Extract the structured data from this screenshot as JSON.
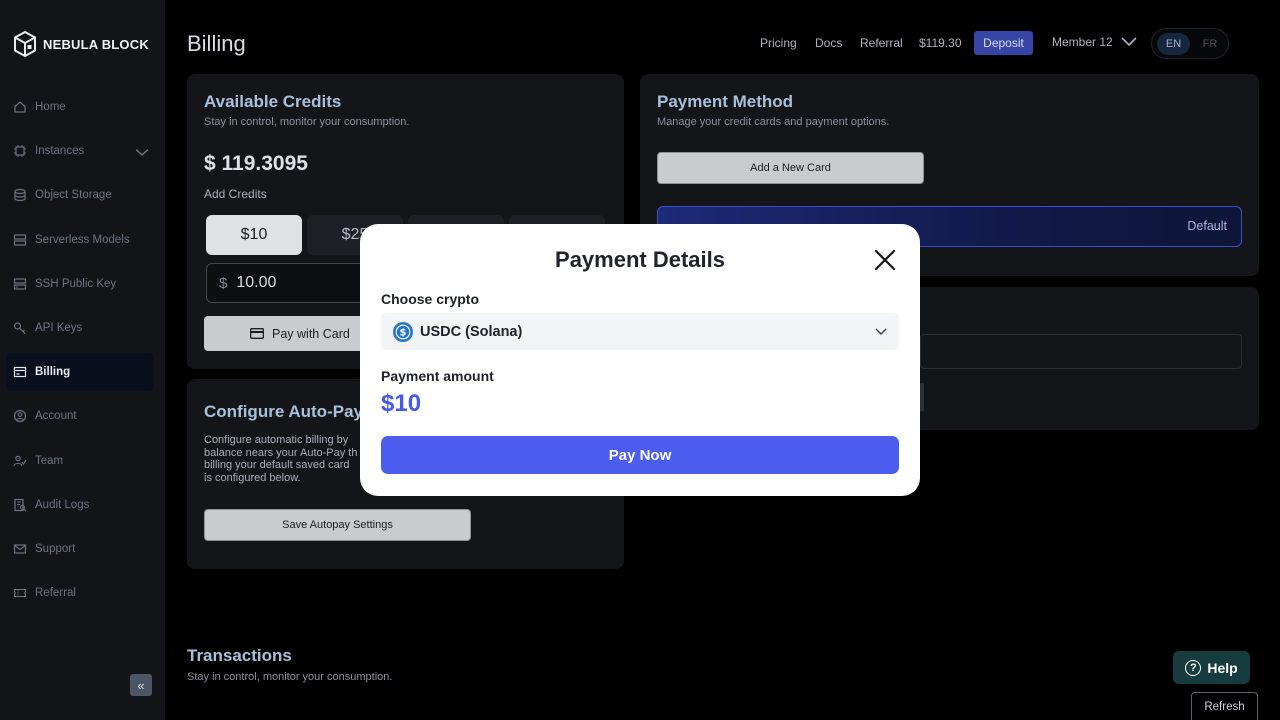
{
  "brand": {
    "name": "NEBULA BLOCK"
  },
  "sidebar": {
    "items": [
      {
        "label": "Home",
        "icon": "home-icon"
      },
      {
        "label": "Instances",
        "icon": "chip-icon"
      },
      {
        "label": "Object Storage",
        "icon": "database-icon"
      },
      {
        "label": "Serverless Models",
        "icon": "server-icon"
      },
      {
        "label": "SSH Public Key",
        "icon": "server-key-icon"
      },
      {
        "label": "API Keys",
        "icon": "key-icon"
      },
      {
        "label": "Billing",
        "icon": "billing-icon"
      },
      {
        "label": "Account",
        "icon": "user-circle-icon"
      },
      {
        "label": "Team",
        "icon": "team-icon"
      },
      {
        "label": "Audit Logs",
        "icon": "audit-icon"
      },
      {
        "label": "Support",
        "icon": "mail-icon"
      },
      {
        "label": "Referral",
        "icon": "ticket-icon"
      }
    ],
    "active": "Billing",
    "collapse_icon": "«"
  },
  "header": {
    "title": "Billing",
    "nav": {
      "pricing": "Pricing",
      "docs": "Docs",
      "referral": "Referral",
      "balance": "$119.30"
    },
    "deposit_label": "Deposit",
    "member": "Member 12",
    "lang": {
      "en": "EN",
      "fr": "FR"
    }
  },
  "credits": {
    "title": "Available Credits",
    "subtitle": "Stay in control, monitor your consumption.",
    "balance": "$ 119.3095",
    "add_label": "Add Credits",
    "amounts": [
      "$10",
      "$25",
      "",
      ""
    ],
    "input_currency": "$",
    "input_value": "10.00",
    "pay_card_label": "Pay with Card"
  },
  "autopay": {
    "title": "Configure Auto-Pay",
    "desc_lines": [
      "Configure automatic billing by",
      "balance nears your Auto-Pay th",
      "billing your default saved card",
      "is configured below."
    ],
    "save_label": "Save Autopay Settings"
  },
  "payment_method": {
    "title": "Payment Method",
    "subtitle": "Manage your credit cards and payment options.",
    "add_card_label": "Add a New Card",
    "default_label": "Default"
  },
  "transactions": {
    "title": "Transactions",
    "subtitle": "Stay in control, monitor your consumption.",
    "refresh_label": "Refresh"
  },
  "help": {
    "label": "Help"
  },
  "modal": {
    "title": "Payment Details",
    "choose_crypto_label": "Choose crypto",
    "crypto_selected": "USDC (Solana)",
    "payment_amount_label": "Payment amount",
    "payment_amount": "$10",
    "pay_now_label": "Pay Now"
  },
  "colors": {
    "accent": "#4b5cef",
    "deposit": "#3745a6",
    "card_title": "#a9c0dc",
    "help": "#173c3f"
  }
}
